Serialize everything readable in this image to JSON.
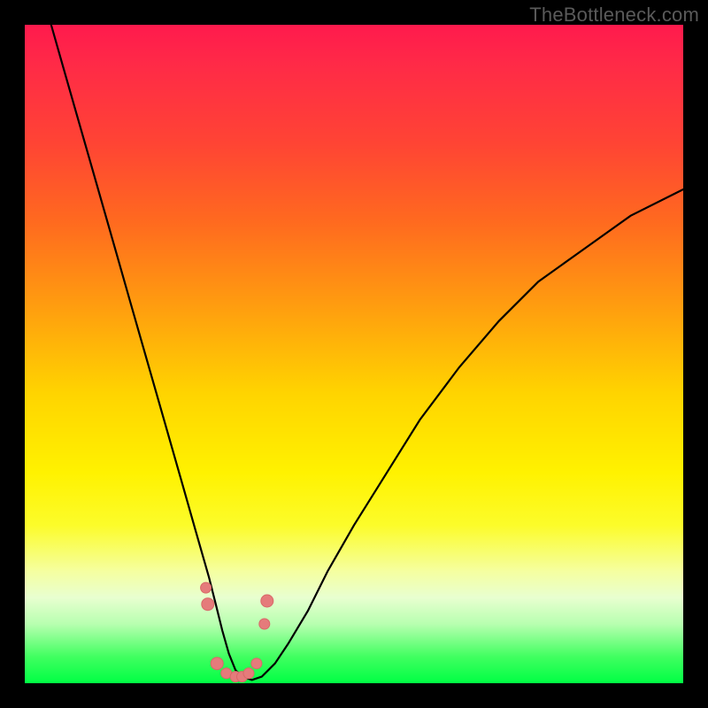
{
  "watermark": "TheBottleneck.com",
  "chart_data": {
    "type": "line",
    "title": "",
    "xlabel": "",
    "ylabel": "",
    "x_range": [
      0,
      100
    ],
    "y_range": [
      0,
      100
    ],
    "series": [
      {
        "name": "bottleneck-curve",
        "x": [
          4,
          6,
          8,
          10,
          12,
          14,
          16,
          18,
          20,
          22,
          24,
          26,
          28,
          29,
          30,
          31,
          32,
          33,
          34.5,
          36,
          38,
          40,
          43,
          46,
          50,
          55,
          60,
          66,
          72,
          78,
          85,
          92,
          100
        ],
        "y": [
          100,
          93,
          86,
          79,
          72,
          65,
          58,
          51,
          44,
          37,
          30,
          23,
          16,
          12,
          8,
          4.5,
          2,
          1,
          0.5,
          1,
          3,
          6,
          11,
          17,
          24,
          32,
          40,
          48,
          55,
          61,
          66,
          71,
          75
        ]
      }
    ],
    "markers": {
      "name": "highlight-dots",
      "x": [
        27.5,
        27.8,
        29.2,
        30.6,
        32.0,
        33.0,
        34.0,
        35.2,
        36.4,
        36.8
      ],
      "y": [
        14.5,
        12.0,
        3.0,
        1.5,
        1.0,
        1.0,
        1.5,
        3.0,
        9.0,
        12.5
      ],
      "r": [
        6,
        7,
        7,
        6,
        6,
        6,
        6,
        6,
        6,
        7
      ]
    },
    "background": {
      "type": "vertical-gradient",
      "stops": [
        {
          "pos": 0.0,
          "color": "#ff1a4d"
        },
        {
          "pos": 0.18,
          "color": "#ff4434"
        },
        {
          "pos": 0.42,
          "color": "#ff9a10"
        },
        {
          "pos": 0.68,
          "color": "#fff200"
        },
        {
          "pos": 0.87,
          "color": "#e8ffd0"
        },
        {
          "pos": 1.0,
          "color": "#00ff44"
        }
      ]
    }
  }
}
